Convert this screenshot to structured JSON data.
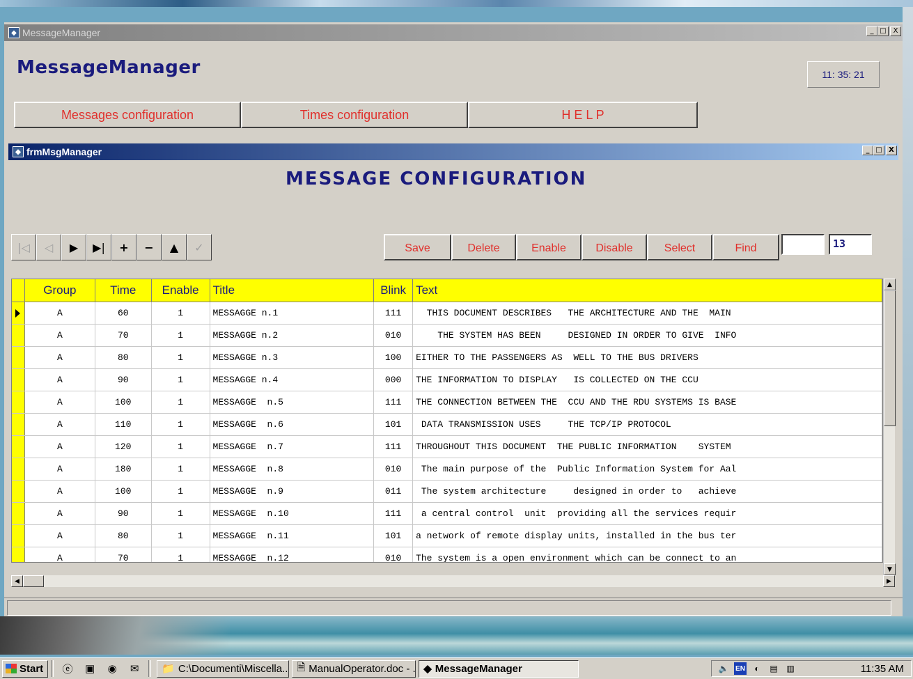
{
  "main_window": {
    "title": "MessageManager",
    "heading": "MessageManager",
    "clock": "11: 35: 21",
    "nav": [
      {
        "label": "Messages configuration"
      },
      {
        "label": "Times configuration"
      },
      {
        "label": "H E L P"
      }
    ],
    "buttons": {
      "minimize": "_",
      "maximize": "□",
      "close": "X"
    }
  },
  "form_window": {
    "title": "frmMsgManager",
    "heading": "MESSAGE  CONFIGURATION",
    "navigator_icons": [
      "first-record-icon",
      "previous-record-icon",
      "next-record-icon",
      "last-record-icon",
      "add-record-icon",
      "delete-record-icon",
      "edit-record-icon",
      "post-record-icon"
    ],
    "actions": {
      "save": "Save",
      "delete": "Delete",
      "enable": "Enable",
      "disable": "Disable",
      "select": "Select",
      "find": "Find"
    },
    "find_value": "",
    "record_count": "13"
  },
  "grid": {
    "columns": [
      "Group",
      "Time",
      "Enable",
      "Title",
      "Blink",
      "Text"
    ],
    "rows": [
      {
        "group": "A",
        "time": "60",
        "enable": "1",
        "title": "MESSAGGE n.1",
        "blink": "111",
        "text": "  THIS DOCUMENT DESCRIBES   THE ARCHITECTURE AND THE  MAIN"
      },
      {
        "group": "A",
        "time": "70",
        "enable": "1",
        "title": "MESSAGGE n.2",
        "blink": "010",
        "text": "    THE SYSTEM HAS BEEN     DESIGNED IN ORDER TO GIVE  INFO"
      },
      {
        "group": "A",
        "time": "80",
        "enable": "1",
        "title": "MESSAGGE n.3",
        "blink": "100",
        "text": "EITHER TO THE PASSENGERS AS  WELL TO THE BUS DRIVERS"
      },
      {
        "group": "A",
        "time": "90",
        "enable": "1",
        "title": "MESSAGGE n.4",
        "blink": "000",
        "text": "THE INFORMATION TO DISPLAY   IS COLLECTED ON THE CCU"
      },
      {
        "group": "A",
        "time": "100",
        "enable": "1",
        "title": "MESSAGGE  n.5",
        "blink": "111",
        "text": "THE CONNECTION BETWEEN THE  CCU AND THE RDU SYSTEMS IS BASE"
      },
      {
        "group": "A",
        "time": "110",
        "enable": "1",
        "title": "MESSAGGE  n.6",
        "blink": "101",
        "text": " DATA TRANSMISSION USES     THE TCP/IP PROTOCOL"
      },
      {
        "group": "A",
        "time": "120",
        "enable": "1",
        "title": "MESSAGGE  n.7",
        "blink": "111",
        "text": "THROUGHOUT THIS DOCUMENT  THE PUBLIC INFORMATION    SYSTEM"
      },
      {
        "group": "A",
        "time": "180",
        "enable": "1",
        "title": "MESSAGGE  n.8",
        "blink": "010",
        "text": " The main purpose of the  Public Information System for Aal"
      },
      {
        "group": "A",
        "time": "100",
        "enable": "1",
        "title": "MESSAGGE  n.9",
        "blink": "011",
        "text": " The system architecture     designed in order to   achieve"
      },
      {
        "group": "A",
        "time": "90",
        "enable": "1",
        "title": "MESSAGGE  n.10",
        "blink": "111",
        "text": " a central control  unit  providing all the services requir"
      },
      {
        "group": "A",
        "time": "80",
        "enable": "1",
        "title": "MESSAGGE  n.11",
        "blink": "101",
        "text": "a network of remote display units, installed in the bus ter"
      },
      {
        "group": "A",
        "time": "70",
        "enable": "1",
        "title": "MESSAGGE  n.12",
        "blink": "010",
        "text": "The system is a open environment which can be connect to an"
      }
    ]
  },
  "taskbar": {
    "start": "Start",
    "tasks": [
      {
        "label": "C:\\Documenti\\Miscella..."
      },
      {
        "label": "ManualOperator.doc - ..."
      },
      {
        "label": "MessageManager"
      }
    ],
    "lang": "EN",
    "clock": "11:35 AM"
  },
  "colors": {
    "heading": "#1a1b7d",
    "button_text": "#e0302c",
    "grid_header": "#ffff00",
    "active_title": "#0a246a"
  }
}
